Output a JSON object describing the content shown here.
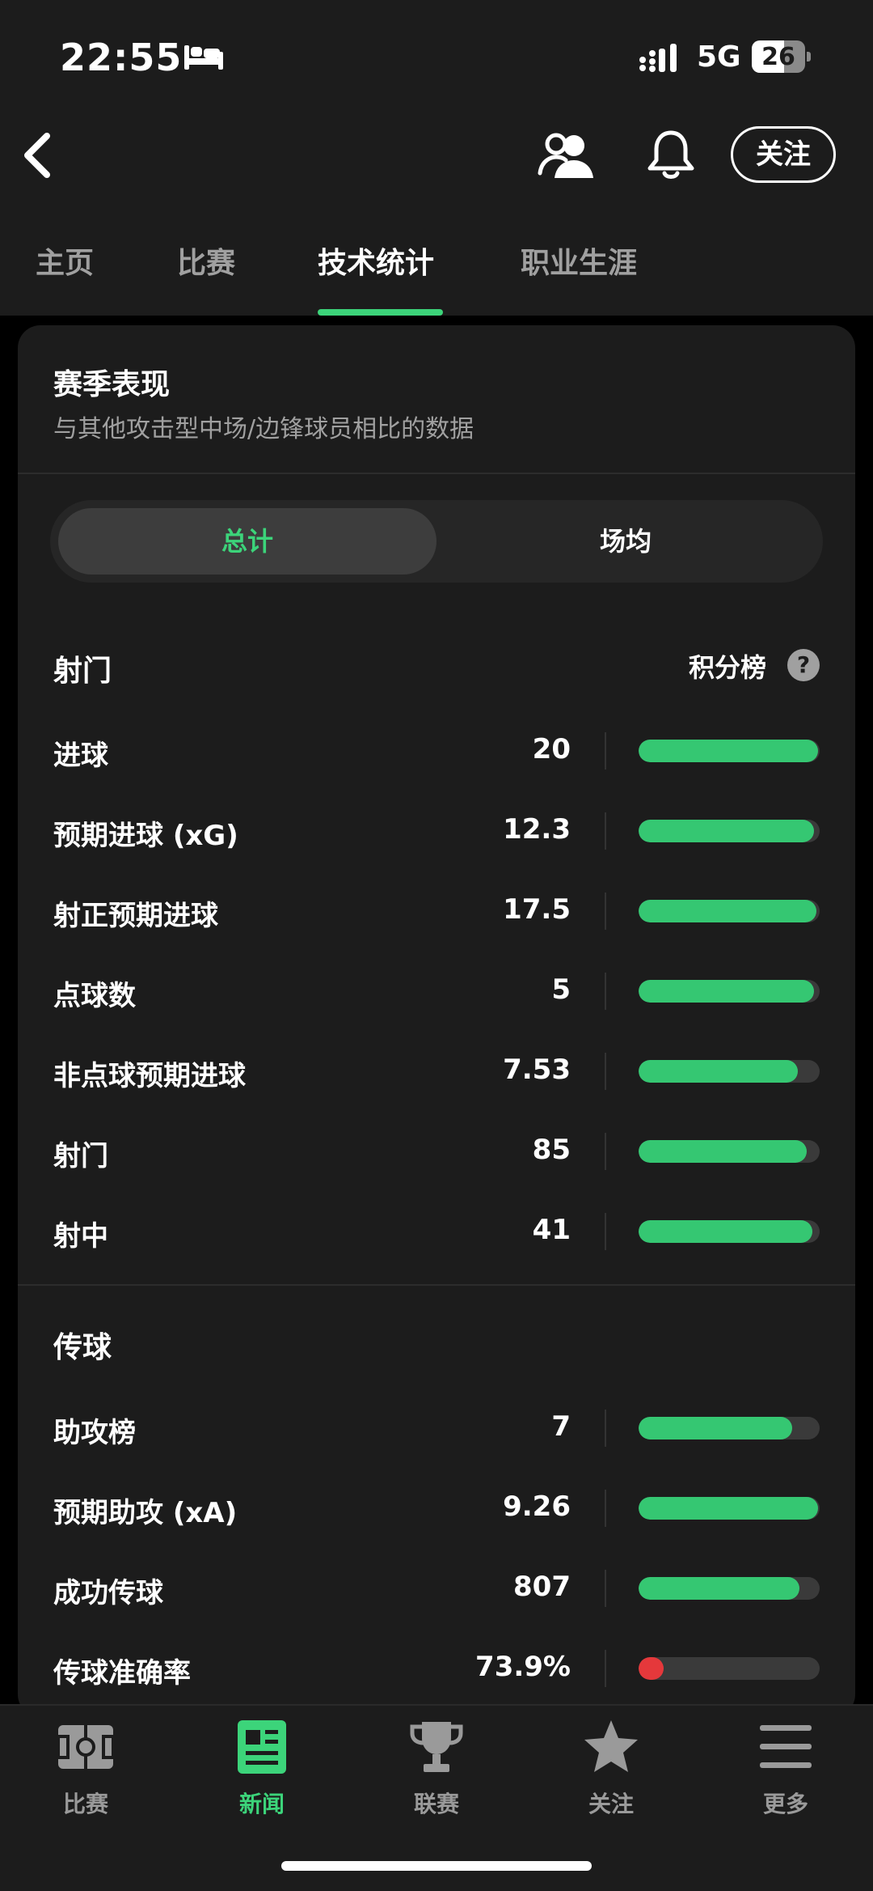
{
  "status_bar": {
    "time": "22:55",
    "network": "5G",
    "battery": "26"
  },
  "header": {
    "follow_label": "关注"
  },
  "tabs": [
    {
      "label": "主页"
    },
    {
      "label": "比赛"
    },
    {
      "label": "技术统计"
    },
    {
      "label": "职业生涯"
    }
  ],
  "card": {
    "title": "赛季表现",
    "subtitle": "与其他攻击型中场/边锋球员相比的数据",
    "segments": {
      "total": "总计",
      "per_game": "场均"
    }
  },
  "shooting": {
    "title": "射门",
    "rank_label": "积分榜",
    "help": "?",
    "rows": [
      {
        "label": "进球",
        "value": "20",
        "pct": 99,
        "color": "#35c772"
      },
      {
        "label": "预期进球 (xG)",
        "value": "12.3",
        "pct": 97,
        "color": "#35c772"
      },
      {
        "label": "射正预期进球",
        "value": "17.5",
        "pct": 98,
        "color": "#35c772"
      },
      {
        "label": "点球数",
        "value": "5",
        "pct": 97,
        "color": "#35c772"
      },
      {
        "label": "非点球预期进球",
        "value": "7.53",
        "pct": 88,
        "color": "#35c772"
      },
      {
        "label": "射门",
        "value": "85",
        "pct": 93,
        "color": "#35c772"
      },
      {
        "label": "射中",
        "value": "41",
        "pct": 96,
        "color": "#35c772"
      }
    ]
  },
  "passing": {
    "title": "传球",
    "rows": [
      {
        "label": "助攻榜",
        "value": "7",
        "pct": 85,
        "color": "#35c772"
      },
      {
        "label": "预期助攻 (xA)",
        "value": "9.26",
        "pct": 99,
        "color": "#35c772"
      },
      {
        "label": "成功传球",
        "value": "807",
        "pct": 89,
        "color": "#35c772"
      },
      {
        "label": "传球准确率",
        "value": "73.9%",
        "pct": 14,
        "color": "#e5383b"
      }
    ]
  },
  "bottom_nav": [
    {
      "label": "比赛",
      "active": false
    },
    {
      "label": "新闻",
      "active": true
    },
    {
      "label": "联赛",
      "active": false
    },
    {
      "label": "关注",
      "active": false
    },
    {
      "label": "更多",
      "active": false
    }
  ],
  "colors": {
    "accent": "#3cd47a",
    "bar_green": "#35c772",
    "bar_red": "#e5383b",
    "background": "#1c1c1c"
  }
}
